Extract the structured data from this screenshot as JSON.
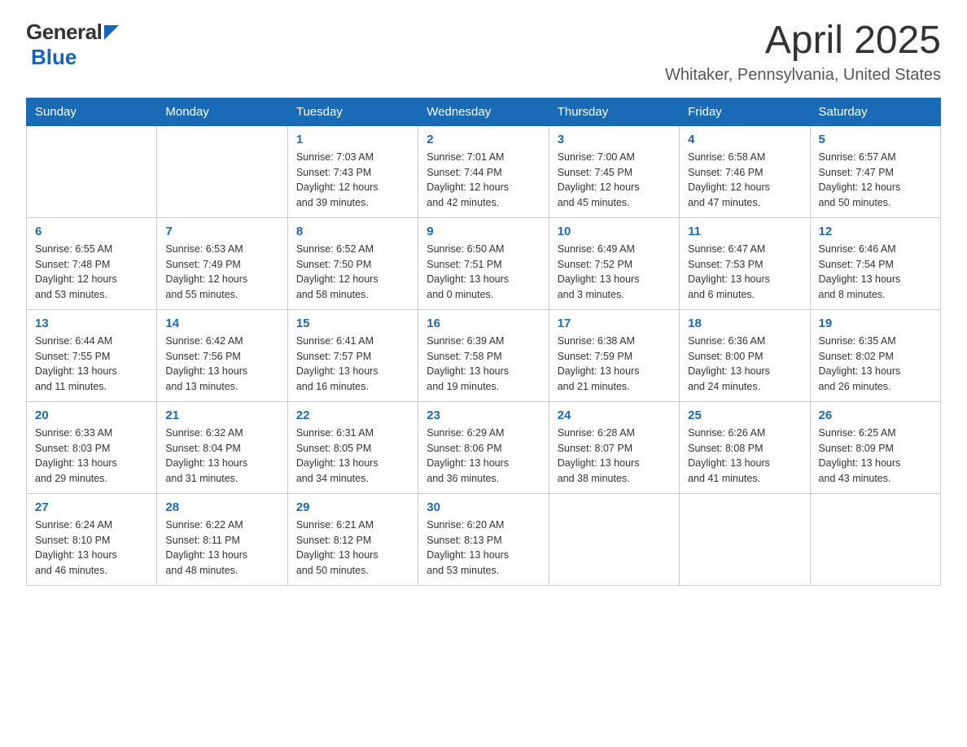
{
  "header": {
    "logo_general": "General",
    "logo_blue": "Blue",
    "title": "April 2025",
    "subtitle": "Whitaker, Pennsylvania, United States"
  },
  "calendar": {
    "days_of_week": [
      "Sunday",
      "Monday",
      "Tuesday",
      "Wednesday",
      "Thursday",
      "Friday",
      "Saturday"
    ],
    "weeks": [
      [
        {
          "day": "",
          "info": ""
        },
        {
          "day": "",
          "info": ""
        },
        {
          "day": "1",
          "info": "Sunrise: 7:03 AM\nSunset: 7:43 PM\nDaylight: 12 hours\nand 39 minutes."
        },
        {
          "day": "2",
          "info": "Sunrise: 7:01 AM\nSunset: 7:44 PM\nDaylight: 12 hours\nand 42 minutes."
        },
        {
          "day": "3",
          "info": "Sunrise: 7:00 AM\nSunset: 7:45 PM\nDaylight: 12 hours\nand 45 minutes."
        },
        {
          "day": "4",
          "info": "Sunrise: 6:58 AM\nSunset: 7:46 PM\nDaylight: 12 hours\nand 47 minutes."
        },
        {
          "day": "5",
          "info": "Sunrise: 6:57 AM\nSunset: 7:47 PM\nDaylight: 12 hours\nand 50 minutes."
        }
      ],
      [
        {
          "day": "6",
          "info": "Sunrise: 6:55 AM\nSunset: 7:48 PM\nDaylight: 12 hours\nand 53 minutes."
        },
        {
          "day": "7",
          "info": "Sunrise: 6:53 AM\nSunset: 7:49 PM\nDaylight: 12 hours\nand 55 minutes."
        },
        {
          "day": "8",
          "info": "Sunrise: 6:52 AM\nSunset: 7:50 PM\nDaylight: 12 hours\nand 58 minutes."
        },
        {
          "day": "9",
          "info": "Sunrise: 6:50 AM\nSunset: 7:51 PM\nDaylight: 13 hours\nand 0 minutes."
        },
        {
          "day": "10",
          "info": "Sunrise: 6:49 AM\nSunset: 7:52 PM\nDaylight: 13 hours\nand 3 minutes."
        },
        {
          "day": "11",
          "info": "Sunrise: 6:47 AM\nSunset: 7:53 PM\nDaylight: 13 hours\nand 6 minutes."
        },
        {
          "day": "12",
          "info": "Sunrise: 6:46 AM\nSunset: 7:54 PM\nDaylight: 13 hours\nand 8 minutes."
        }
      ],
      [
        {
          "day": "13",
          "info": "Sunrise: 6:44 AM\nSunset: 7:55 PM\nDaylight: 13 hours\nand 11 minutes."
        },
        {
          "day": "14",
          "info": "Sunrise: 6:42 AM\nSunset: 7:56 PM\nDaylight: 13 hours\nand 13 minutes."
        },
        {
          "day": "15",
          "info": "Sunrise: 6:41 AM\nSunset: 7:57 PM\nDaylight: 13 hours\nand 16 minutes."
        },
        {
          "day": "16",
          "info": "Sunrise: 6:39 AM\nSunset: 7:58 PM\nDaylight: 13 hours\nand 19 minutes."
        },
        {
          "day": "17",
          "info": "Sunrise: 6:38 AM\nSunset: 7:59 PM\nDaylight: 13 hours\nand 21 minutes."
        },
        {
          "day": "18",
          "info": "Sunrise: 6:36 AM\nSunset: 8:00 PM\nDaylight: 13 hours\nand 24 minutes."
        },
        {
          "day": "19",
          "info": "Sunrise: 6:35 AM\nSunset: 8:02 PM\nDaylight: 13 hours\nand 26 minutes."
        }
      ],
      [
        {
          "day": "20",
          "info": "Sunrise: 6:33 AM\nSunset: 8:03 PM\nDaylight: 13 hours\nand 29 minutes."
        },
        {
          "day": "21",
          "info": "Sunrise: 6:32 AM\nSunset: 8:04 PM\nDaylight: 13 hours\nand 31 minutes."
        },
        {
          "day": "22",
          "info": "Sunrise: 6:31 AM\nSunset: 8:05 PM\nDaylight: 13 hours\nand 34 minutes."
        },
        {
          "day": "23",
          "info": "Sunrise: 6:29 AM\nSunset: 8:06 PM\nDaylight: 13 hours\nand 36 minutes."
        },
        {
          "day": "24",
          "info": "Sunrise: 6:28 AM\nSunset: 8:07 PM\nDaylight: 13 hours\nand 38 minutes."
        },
        {
          "day": "25",
          "info": "Sunrise: 6:26 AM\nSunset: 8:08 PM\nDaylight: 13 hours\nand 41 minutes."
        },
        {
          "day": "26",
          "info": "Sunrise: 6:25 AM\nSunset: 8:09 PM\nDaylight: 13 hours\nand 43 minutes."
        }
      ],
      [
        {
          "day": "27",
          "info": "Sunrise: 6:24 AM\nSunset: 8:10 PM\nDaylight: 13 hours\nand 46 minutes."
        },
        {
          "day": "28",
          "info": "Sunrise: 6:22 AM\nSunset: 8:11 PM\nDaylight: 13 hours\nand 48 minutes."
        },
        {
          "day": "29",
          "info": "Sunrise: 6:21 AM\nSunset: 8:12 PM\nDaylight: 13 hours\nand 50 minutes."
        },
        {
          "day": "30",
          "info": "Sunrise: 6:20 AM\nSunset: 8:13 PM\nDaylight: 13 hours\nand 53 minutes."
        },
        {
          "day": "",
          "info": ""
        },
        {
          "day": "",
          "info": ""
        },
        {
          "day": "",
          "info": ""
        }
      ]
    ]
  }
}
